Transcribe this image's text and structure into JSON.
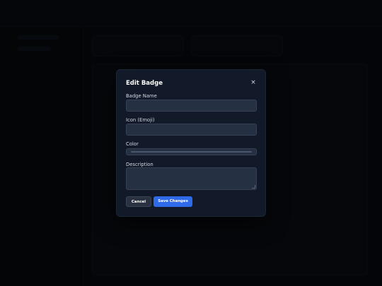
{
  "modal": {
    "title": "Edit Badge",
    "close_symbol": "×",
    "fields": {
      "badge_name": {
        "label": "Badge Name",
        "value": "",
        "placeholder": ""
      },
      "icon": {
        "label": "Icon (Emoji)",
        "value": "",
        "placeholder": ""
      },
      "color": {
        "label": "Color"
      },
      "description": {
        "label": "Description",
        "value": ""
      }
    },
    "buttons": {
      "cancel": "Cancel",
      "save": "Save Changes"
    }
  },
  "colors": {
    "modal_bg": "#121a29",
    "input_bg": "#263043",
    "primary": "#2f6be8",
    "secondary": "#2a3242"
  },
  "icons": {
    "close": "close-icon"
  }
}
